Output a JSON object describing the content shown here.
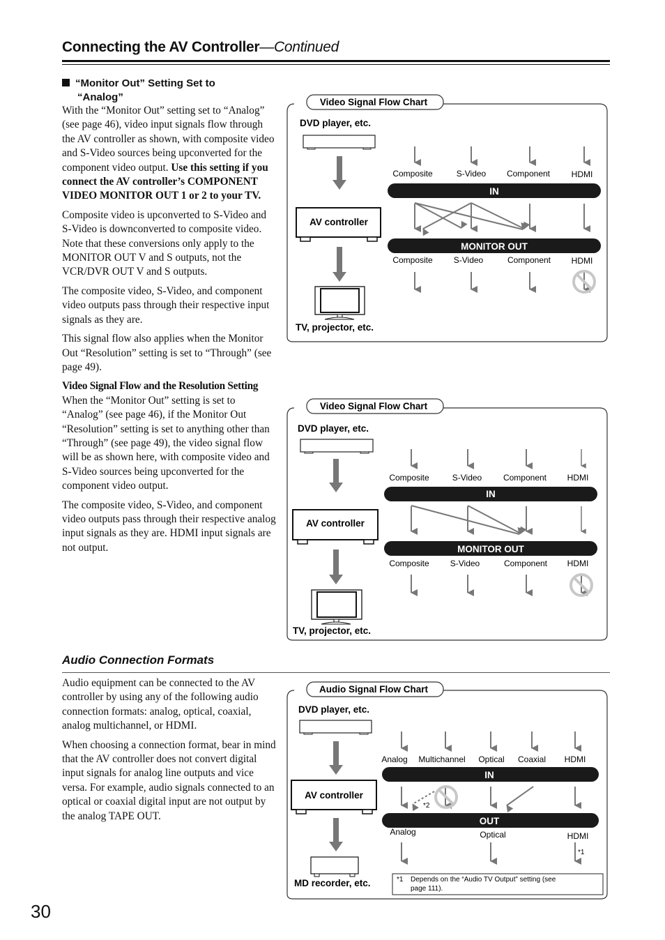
{
  "header": {
    "title": "Connecting the AV Controller",
    "continued": "—Continued"
  },
  "section1": {
    "heading_line1": "“Monitor Out” Setting Set to",
    "heading_line2": "“Analog”",
    "p1_plain": "With the “Monitor Out” setting set to “Analog” (see page 46), video input signals flow through the AV controller as shown, with composite video and S-Video sources being upconverted for the component video output. ",
    "p1_bold": "Use this setting if you connect the AV controller’s COMPONENT VIDEO MONITOR OUT 1 or 2 to your TV.",
    "p2": "Composite video is upconverted to S-Video and S-Video is downconverted to composite video. Note that these conversions only apply to the MONITOR OUT V and S outputs, not the VCR/DVR OUT V and S outputs.",
    "p3": "The composite video, S-Video, and component video outputs pass through their respective input signals as they are.",
    "p4": "This signal flow also applies when the Monitor Out “Resolution” setting is set to “Through” (see page 49).",
    "sub_heading": "Video Signal Flow and the Resolution Setting",
    "p5": "When the “Monitor Out” setting is set to “Analog” (see page 46), if the Monitor Out “Resolution” setting is set to anything other than “Through” (see page 49), the video signal flow will be as shown here, with composite video and S-Video sources being upconverted for the component video output.",
    "p6": "The composite video, S-Video, and component video outputs pass through their respective analog input signals as they are. HDMI input signals are not output."
  },
  "section2": {
    "title": "Audio Connection Formats",
    "p1": "Audio equipment can be connected to the AV controller by using any of the following audio connection formats: analog, optical, coaxial, analog multichannel, or HDMI.",
    "p2": "When choosing a connection format, bear in mind that the AV controller does not convert digital input signals for analog line outputs and vice versa. For example, audio signals connected to an optical or coaxial digital input are not output by the analog TAPE OUT."
  },
  "diagrams": {
    "video1": {
      "title": "Video Signal Flow Chart",
      "source_label": "DVD player, etc.",
      "controller_label": "AV controller",
      "sink_label": "TV, projector, etc.",
      "in_bar": "IN",
      "out_bar": "MONITOR OUT",
      "inputs": [
        "Composite",
        "S-Video",
        "Component",
        "HDMI"
      ],
      "outputs": [
        "Composite",
        "S-Video",
        "Component",
        "HDMI"
      ],
      "blocked_output": "HDMI"
    },
    "video2": {
      "title": "Video Signal Flow Chart",
      "source_label": "DVD player, etc.",
      "controller_label": "AV controller",
      "sink_label": "TV, projector, etc.",
      "in_bar": "IN",
      "out_bar": "MONITOR OUT",
      "inputs": [
        "Composite",
        "S-Video",
        "Component",
        "HDMI"
      ],
      "outputs": [
        "Composite",
        "S-Video",
        "Component",
        "HDMI"
      ],
      "blocked_output": "HDMI"
    },
    "audio": {
      "title": "Audio Signal Flow Chart",
      "source_label": "DVD player, etc.",
      "controller_label": "AV controller",
      "sink_label": "MD recorder, etc.",
      "in_bar": "IN",
      "out_bar": "OUT",
      "inputs": [
        "Analog",
        "Multichannel",
        "Optical",
        "Coaxial",
        "HDMI"
      ],
      "outputs": [
        "Analog",
        "Optical",
        "HDMI"
      ],
      "note_mark_2": "*2",
      "note_mark_1": "*1",
      "footnote_mark": "*1",
      "footnote_text_line1": "Depends on the “Audio TV Output” setting (see",
      "footnote_text_line2": "page 111)."
    }
  },
  "colors": {
    "arrow": "#777777",
    "bar": "#1a1a1a",
    "prohibit": "#c8c8c8"
  },
  "page_number": "30"
}
